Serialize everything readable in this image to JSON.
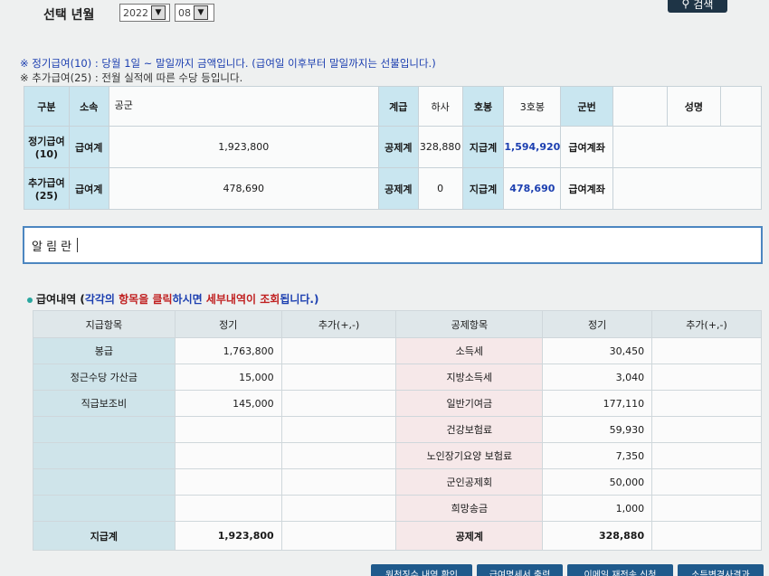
{
  "search": {
    "date_label": "선택 년월",
    "year": "2022",
    "month": "08",
    "button_label": "검색"
  },
  "notes": [
    "※ 정기급여(10) : 당월 1일 ~ 말일까지 금액입니다. (급여일 이후부터 말일까지는 선불입니다.)",
    "※ 추가급여(25) : 전월 실적에 따른 수당 등입니다."
  ],
  "info": {
    "labels": {
      "gubun": "구분",
      "sosok": "소속",
      "gyegeup": "계급",
      "hobong": "호봉",
      "gunbeon": "군번",
      "seongmyeong": "성명",
      "gongjegye": "공제계",
      "jigeupgye": "지급계",
      "geupyeogye": "급여계",
      "geupyeo_account": "급여계좌"
    },
    "sosok_value": "공군",
    "rank": "하사",
    "hobong_value": "3호봉",
    "rows": [
      {
        "label": "정기급여(10)",
        "amount": "1,923,800",
        "deduction": "328,880",
        "payment": "1,594,920"
      },
      {
        "label": "추가급여(25)",
        "amount": "478,690",
        "deduction": "0",
        "payment": "478,690"
      }
    ]
  },
  "notice": {
    "label": "알 림 란"
  },
  "section": {
    "prefix": "급여내역 (",
    "part1": "각각의 ",
    "part2": "항목을 클릭",
    "part3": "하시면 ",
    "part4": "세부내역이 조회",
    "part5": "됩니다.)"
  },
  "pay_table": {
    "headers": {
      "pay_item": "지급항목",
      "regular": "정기",
      "extra": "추가(+,-)",
      "deduct_item": "공제항목",
      "regular2": "정기",
      "extra2": "추가(+,-)"
    },
    "pay_rows": [
      {
        "name": "봉급",
        "regular": "1,763,800"
      },
      {
        "name": "정근수당 가산금",
        "regular": "15,000"
      },
      {
        "name": "직급보조비",
        "regular": "145,000"
      }
    ],
    "deduct_rows": [
      {
        "name": "소득세",
        "regular": "30,450"
      },
      {
        "name": "지방소득세",
        "regular": "3,040"
      },
      {
        "name": "일반기여금",
        "regular": "177,110"
      },
      {
        "name": "건강보험료",
        "regular": "59,930"
      },
      {
        "name": "노인장기요양 보험료",
        "regular": "7,350"
      },
      {
        "name": "군인공제회",
        "regular": "50,000"
      },
      {
        "name": "희망송금",
        "regular": "1,000"
      }
    ],
    "total_pay_label": "지급계",
    "total_pay": "1,923,800",
    "total_deduct_label": "공제계",
    "total_deduct": "328,880"
  },
  "bottom_buttons": [
    "원천징수 내역 확인",
    "급여명세서 출력",
    "이메일 재전송 신청",
    "소득변경사결과"
  ]
}
